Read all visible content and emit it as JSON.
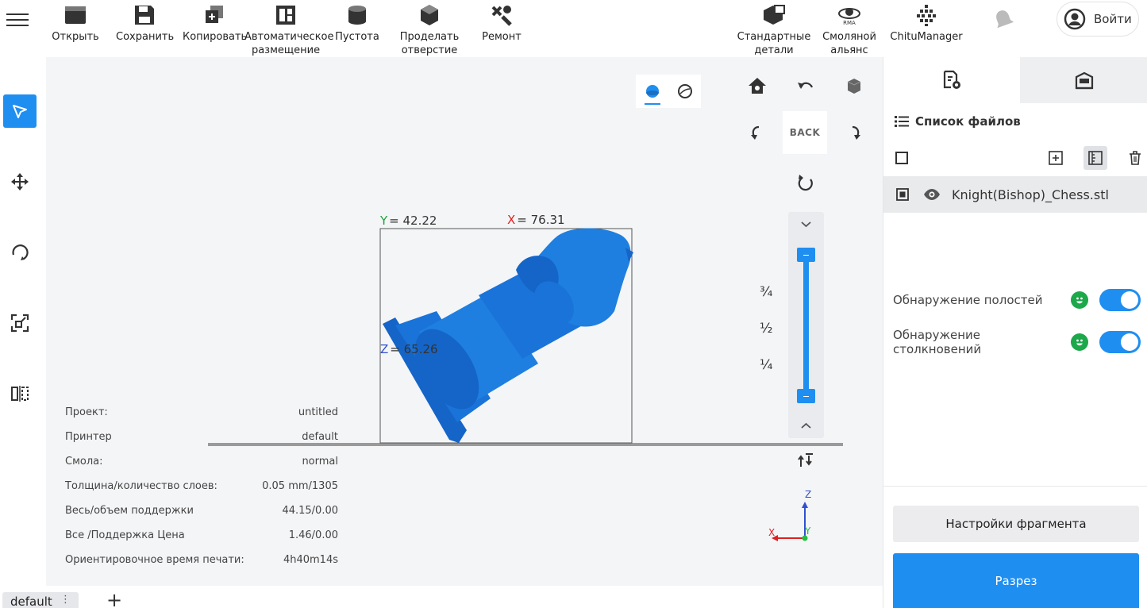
{
  "toolbar": {
    "items": [
      {
        "label": "Открыть",
        "icon": "open-folder-icon"
      },
      {
        "label": "Сохранить",
        "icon": "save-icon"
      },
      {
        "label": "Копировать",
        "icon": "copy-icon"
      },
      {
        "label": "Автоматическое размещение",
        "icon": "auto-layout-icon"
      },
      {
        "label": "Пустота",
        "icon": "hollow-icon"
      },
      {
        "label": "Проделать отверстие",
        "icon": "punch-hole-icon"
      },
      {
        "label": "Ремонт",
        "icon": "repair-icon"
      }
    ],
    "right_items": [
      {
        "label": "Стандартные детали",
        "icon": "standard-parts-icon"
      },
      {
        "label": "Смоляной альянс",
        "icon": "resin-alliance-icon"
      },
      {
        "label": "ChituManager",
        "icon": "chitumanager-icon"
      }
    ],
    "rma_text": "RMA",
    "login_label": "Войти"
  },
  "view": {
    "back_label": "BACK",
    "fractions": [
      "¾",
      "½",
      "¼"
    ],
    "dims": {
      "y_axis": "Y",
      "y_value": "= 42.22",
      "x_axis": "X",
      "x_value": "= 76.31",
      "z_axis": "Z",
      "z_value": "= 65.26"
    },
    "axis_labels": {
      "x": "X",
      "y": "Y",
      "z": "Z"
    },
    "slider": {
      "lower": 0.0,
      "upper": 1.0
    },
    "colors": {
      "model": "#1a73d9",
      "accent": "#1f8ef1",
      "axis_x": "#e02020",
      "axis_y": "#20c040",
      "axis_z": "#3050d0"
    }
  },
  "info": {
    "rows": [
      {
        "label": "Проект:",
        "value": "untitled"
      },
      {
        "label": "Принтер",
        "value": "default"
      },
      {
        "label": "Смола:",
        "value": "normal"
      },
      {
        "label": "Толщина/количество слоев:",
        "value": "0.05 mm/1305"
      },
      {
        "label": "Весь/объем поддержки",
        "value": "44.15/0.00"
      },
      {
        "label": "Все /Поддержка Цена",
        "value": "1.46/0.00"
      },
      {
        "label": "Ориентировочное время печати:",
        "value": "4h40m14s"
      }
    ]
  },
  "bottom": {
    "tab_label": "default",
    "tab_menu": "⋮",
    "add_label": "+"
  },
  "right": {
    "file_list_title": "Список файлов",
    "file_name": "Knight(Bishop)_Chess.stl",
    "detections": [
      {
        "label": "Обнаружение полостей",
        "on": true
      },
      {
        "label": "Обнаружение столкновений",
        "on": true
      }
    ],
    "settings_label": "Настройки фрагмента",
    "slice_label": "Разрез"
  }
}
